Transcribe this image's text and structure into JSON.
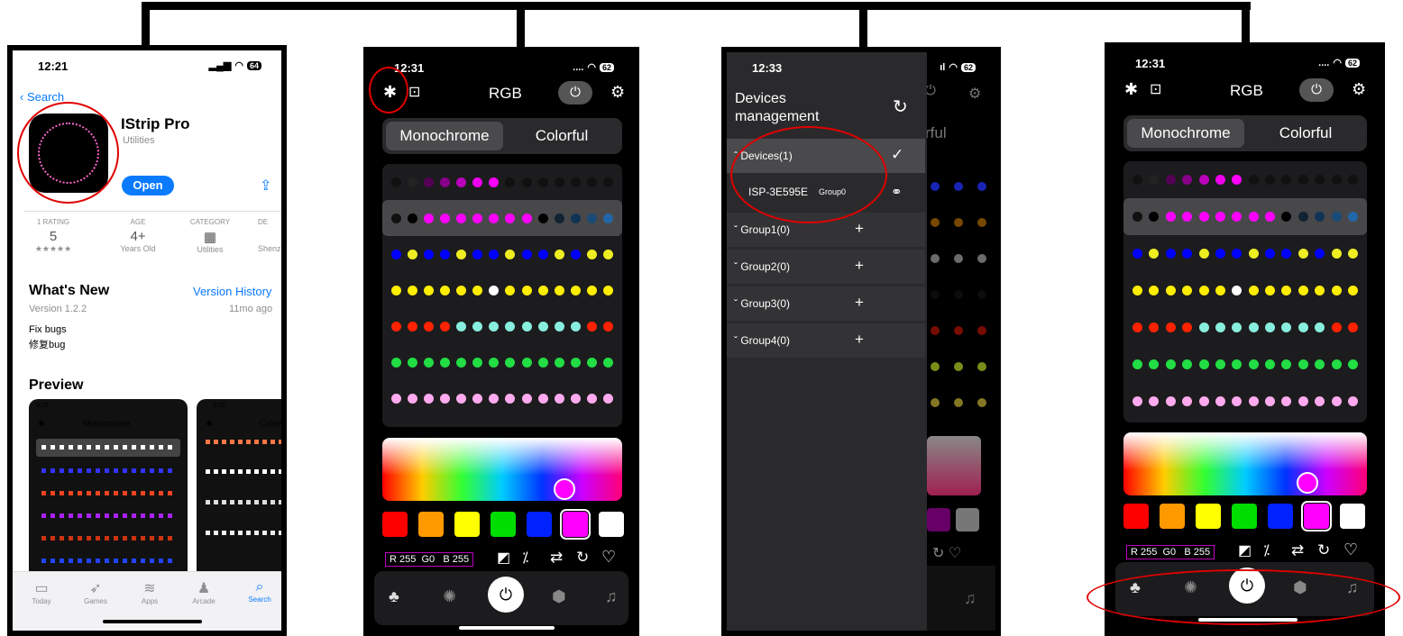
{
  "connector": {
    "color": "#000000"
  },
  "appstore": {
    "time": "12:21",
    "battery": "64",
    "back": "Search",
    "app_name": "IStrip Pro",
    "category_sub": "Utilities",
    "open": "Open",
    "icon_text_1": "iStrip",
    "icon_text_2": "pro",
    "stats": [
      {
        "head": "1 RATING",
        "value": "5",
        "sub": "★★★★★"
      },
      {
        "head": "AGE",
        "value": "4+",
        "sub": "Years Old"
      },
      {
        "head": "CATEGORY",
        "value": "",
        "sub": "Utilities"
      },
      {
        "head": "DE",
        "value": "",
        "sub": "Shenzh"
      }
    ],
    "whats_new": "What's New",
    "version_history": "Version History",
    "version": "Version 1.2.2",
    "ago": "11mo ago",
    "notes": [
      "Fix bugs",
      "修复bug"
    ],
    "preview": "Preview",
    "preview_cards": [
      {
        "time": "3:15",
        "title": "Monochrome"
      },
      {
        "time": "3:15",
        "title": "Colorfu"
      }
    ],
    "tabs": [
      "Today",
      "Games",
      "Apps",
      "Arcade",
      "Search"
    ]
  },
  "rgb": {
    "time1": "12:31",
    "time2": "12:31",
    "battery": "62",
    "title": "RGB",
    "mode_mono": "Monochrome",
    "mode_color": "Colorful",
    "readout": {
      "r": "R 255",
      "g": "G0",
      "b": "B 255"
    },
    "swatches": [
      "#ff0000",
      "#ff9900",
      "#ffff00",
      "#00dd00",
      "#0022ff",
      "#ff00ff",
      "#ffffff"
    ],
    "patterns": [
      [
        "#111",
        "#222",
        "#550055",
        "#880088",
        "#bb00bb",
        "#ee00ee",
        "#ff00ff",
        "#111",
        "#111",
        "#111",
        "#111",
        "#111",
        "#111",
        "#111"
      ],
      [
        "#111",
        "#000",
        "#ff00ff",
        "#ff00ff",
        "#ff00ff",
        "#ff00ff",
        "#ff00ff",
        "#ff00ff",
        "#ff00ff",
        "#000",
        "#112233",
        "#113355",
        "#1a4a77",
        "#2266aa"
      ],
      [
        "#0000ff",
        "#eeee22",
        "#0000ff",
        "#0000ff",
        "#eeee22",
        "#0000ff",
        "#0000ff",
        "#eeee22",
        "#0000ff",
        "#0000ff",
        "#eeee22",
        "#0000ff",
        "#eeee22",
        "#eeee22"
      ],
      [
        "#ffee00",
        "#ffee00",
        "#ffee00",
        "#ffee00",
        "#ffee00",
        "#ffee00",
        "#ffffff",
        "#ffee00",
        "#ffee00",
        "#ffee00",
        "#ffee00",
        "#ffee00",
        "#ffee00",
        "#ffee00"
      ],
      [
        "#ff2200",
        "#ff2200",
        "#ff2200",
        "#ff2200",
        "#88eedd",
        "#88eedd",
        "#88eedd",
        "#88eedd",
        "#88eedd",
        "#88eedd",
        "#88eedd",
        "#88eedd",
        "#ff2200",
        "#ff2200"
      ],
      [
        "#22dd44",
        "#22dd44",
        "#22dd44",
        "#22dd44",
        "#22dd44",
        "#22dd44",
        "#22dd44",
        "#22dd44",
        "#22dd44",
        "#22dd44",
        "#22dd44",
        "#22dd44",
        "#22dd44",
        "#22dd44"
      ],
      [
        "#ffaaee",
        "#ffaaee",
        "#ffaaee",
        "#ffaaee",
        "#ffaaee",
        "#ffaaee",
        "#ffaaee",
        "#ffaaee",
        "#ffaaee",
        "#ffaaee",
        "#ffaaee",
        "#ffaaee",
        "#ffaaee",
        "#ffaaee"
      ]
    ]
  },
  "devices": {
    "time": "12:33",
    "battery": "62",
    "title_1": "Devices",
    "title_2": "management",
    "rows": [
      {
        "label": "Devices(1)",
        "action": "✓",
        "expanded": true
      },
      {
        "label": "Group1(0)",
        "action": "+"
      },
      {
        "label": "Group2(0)",
        "action": "+"
      },
      {
        "label": "Group3(0)",
        "action": "+"
      },
      {
        "label": "Group4(0)",
        "action": "+"
      }
    ],
    "device": {
      "name": "ISP-3E595E",
      "group": "Group0"
    },
    "behind_text": "rful"
  },
  "colors": {
    "accent_red": "#e00000",
    "pink": "#ff00ff"
  }
}
